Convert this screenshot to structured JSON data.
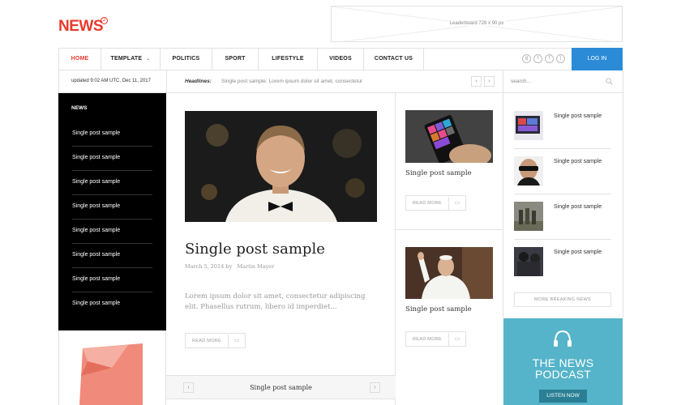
{
  "header": {
    "logo": "NEWS",
    "logo_badge": "2",
    "leaderboard": "Leaderboard  728 x 90 px"
  },
  "nav": {
    "items": [
      "HOME",
      "TEMPLATE",
      "POLITICS",
      "SPORT",
      "LIFESTYLE",
      "VIDEOS",
      "CONTACT US"
    ],
    "active": "HOME",
    "login": "LOG IN",
    "social_icons": [
      "googleplus-icon",
      "twitter-icon",
      "facebook-icon",
      "rss-icon"
    ]
  },
  "subheader": {
    "updated": "updated 9:02 AM UTC, Dec 11, 2017",
    "headlines_label": "Headlines:",
    "headlines_text": "Single post sample: Lorem ipsum dolor sit amet, consectetur",
    "search_placeholder": "search..."
  },
  "left_sidebar": {
    "title": "NEWS",
    "items": [
      "Single post sample",
      "Single post sample",
      "Single post sample",
      "Single post sample",
      "Single post sample",
      "Single post sample",
      "Single post sample",
      "Single post sample"
    ]
  },
  "main": {
    "title": "Single post sample",
    "date": "March 5, 2014",
    "by": "by",
    "author": "Martin Mayer",
    "excerpt": "Lorem ipsum dolor sit amet, consectetur adipiscing elit. Phasellus rutrum, libero id imperdiet...",
    "read_more": "READ MORE",
    "slider_title": "Single post sample"
  },
  "middle": {
    "posts": [
      {
        "title": "Single post sample",
        "read_more": "READ MORE"
      },
      {
        "title": "Single post sample",
        "read_more": "READ MORE"
      }
    ]
  },
  "right": {
    "items": [
      "Single post sample",
      "Single post sample",
      "Single post sample",
      "Single post sample"
    ],
    "more_button": "MORE BREAKING NEWS",
    "podcast_line1": "THE NEWS",
    "podcast_line2": "PODCAST",
    "listen": "LISTEN NOW"
  },
  "colors": {
    "accent_red": "#e8392c",
    "login_blue": "#2b8bd6",
    "podcast_teal": "#55b4c9"
  }
}
